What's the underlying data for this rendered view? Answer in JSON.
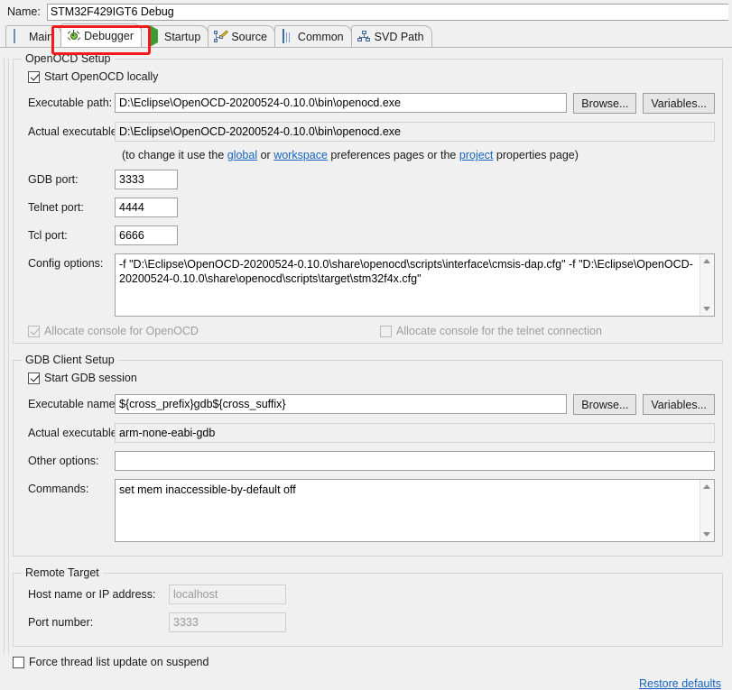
{
  "name_row": {
    "label": "Name:",
    "value": "STM32F429IGT6 Debug"
  },
  "tabs": [
    {
      "label": "Main",
      "icon": "document-icon",
      "active": false
    },
    {
      "label": "Debugger",
      "icon": "bug-icon",
      "active": true
    },
    {
      "label": "Startup",
      "icon": "play-icon",
      "active": false
    },
    {
      "label": "Source",
      "icon": "source-tree-icon",
      "active": false
    },
    {
      "label": "Common",
      "icon": "table-icon",
      "active": false
    },
    {
      "label": "SVD Path",
      "icon": "hierarchy-icon",
      "active": false
    }
  ],
  "openocd": {
    "legend": "OpenOCD Setup",
    "start_locally_label": "Start OpenOCD locally",
    "start_locally_checked": true,
    "executable_path_label": "Executable path:",
    "executable_path_value": "D:\\Eclipse\\OpenOCD-20200524-0.10.0\\bin\\openocd.exe",
    "browse_label": "Browse...",
    "variables_label": "Variables...",
    "actual_executable_label": "Actual executable:",
    "actual_executable_value": "D:\\Eclipse\\OpenOCD-20200524-0.10.0\\bin\\openocd.exe",
    "hint_prefix": "(to change it use the ",
    "hint_link_global": "global",
    "hint_mid1": " or ",
    "hint_link_workspace": "workspace",
    "hint_mid2": " preferences pages or the ",
    "hint_link_project": "project",
    "hint_suffix": " properties page)",
    "gdb_port_label": "GDB port:",
    "gdb_port_value": "3333",
    "telnet_port_label": "Telnet port:",
    "telnet_port_value": "4444",
    "tcl_port_label": "Tcl port:",
    "tcl_port_value": "6666",
    "config_options_label": "Config options:",
    "config_options_value": "-f \"D:\\Eclipse\\OpenOCD-20200524-0.10.0\\share\\openocd\\scripts\\interface\\cmsis-dap.cfg\" -f \"D:\\Eclipse\\OpenOCD-20200524-0.10.0\\share\\openocd\\scripts\\target\\stm32f4x.cfg\"",
    "alloc_console_openocd_label": "Allocate console for OpenOCD",
    "alloc_console_openocd_checked": true,
    "alloc_console_openocd_disabled": true,
    "alloc_console_telnet_label": "Allocate console for the telnet connection",
    "alloc_console_telnet_checked": false,
    "alloc_console_telnet_disabled": true
  },
  "gdb_client": {
    "legend": "GDB Client Setup",
    "start_session_label": "Start GDB session",
    "start_session_checked": true,
    "executable_name_label": "Executable name:",
    "executable_name_value": "${cross_prefix}gdb${cross_suffix}",
    "browse_label": "Browse...",
    "variables_label": "Variables...",
    "actual_executable_label": "Actual executable:",
    "actual_executable_value": "arm-none-eabi-gdb",
    "other_options_label": "Other options:",
    "other_options_value": "",
    "commands_label": "Commands:",
    "commands_value": "set mem inaccessible-by-default off"
  },
  "remote_target": {
    "legend": "Remote Target",
    "host_label": "Host name or IP address:",
    "host_value": "localhost",
    "port_label": "Port number:",
    "port_value": "3333"
  },
  "footer": {
    "force_thread_label": "Force thread list update on suspend",
    "force_thread_checked": false,
    "restore_defaults_label": "Restore defaults"
  },
  "colors": {
    "accent_link": "#1565c0",
    "highlight_box": "#f21b1b",
    "bug_green": "#7ebf4a",
    "play_green": "#3a9e38"
  }
}
